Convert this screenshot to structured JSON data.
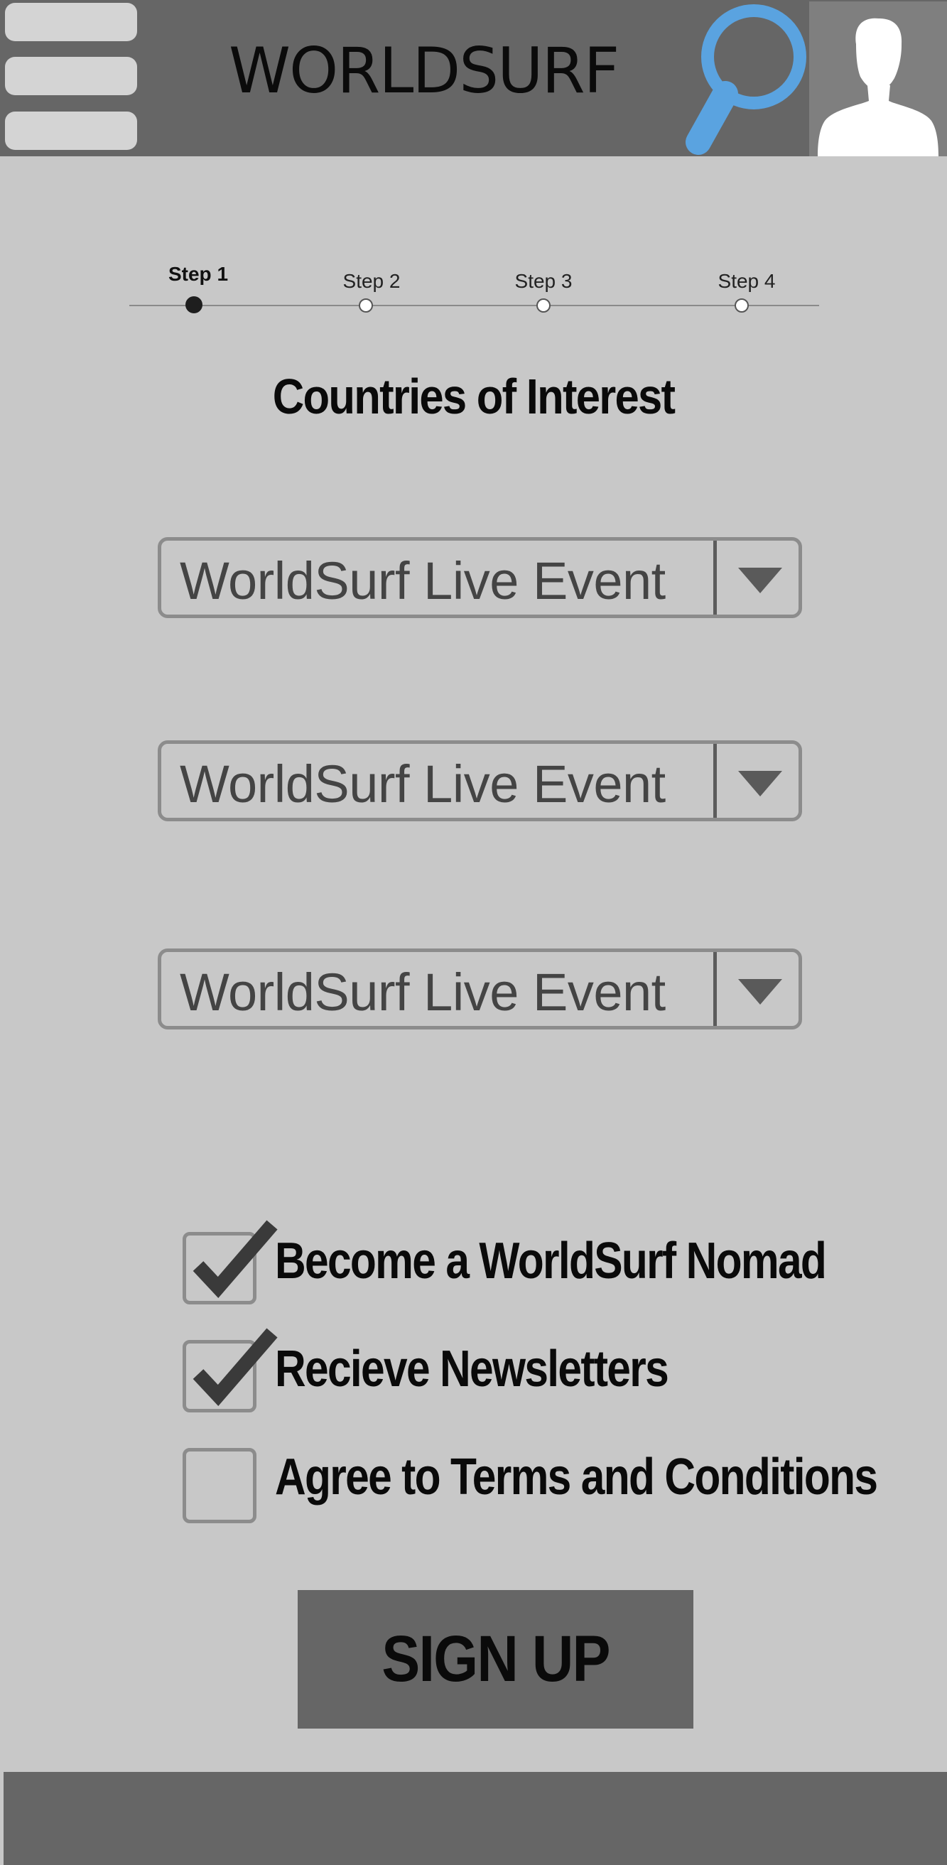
{
  "header": {
    "title": "WORLDSURF",
    "menu_icon": "hamburger-menu-icon",
    "search_icon": "search-icon",
    "avatar_icon": "user-avatar-icon",
    "search_color": "#5aa3e0"
  },
  "stepper": {
    "steps": [
      {
        "label": "Step 1",
        "active": true
      },
      {
        "label": "Step 2",
        "active": false
      },
      {
        "label": "Step 3",
        "active": false
      },
      {
        "label": "Step 4",
        "active": false
      }
    ]
  },
  "main": {
    "title": "Countries of Interest",
    "dropdowns": [
      {
        "value": "WorldSurf Live Event"
      },
      {
        "value": "WorldSurf Live Event"
      },
      {
        "value": "WorldSurf Live Event"
      }
    ],
    "checkboxes": [
      {
        "label": "Become a WorldSurf Nomad",
        "checked": true
      },
      {
        "label": "Recieve Newsletters",
        "checked": true
      },
      {
        "label": "Agree to Terms and Conditions",
        "checked": false
      }
    ],
    "signup_label": "SIGN UP"
  }
}
